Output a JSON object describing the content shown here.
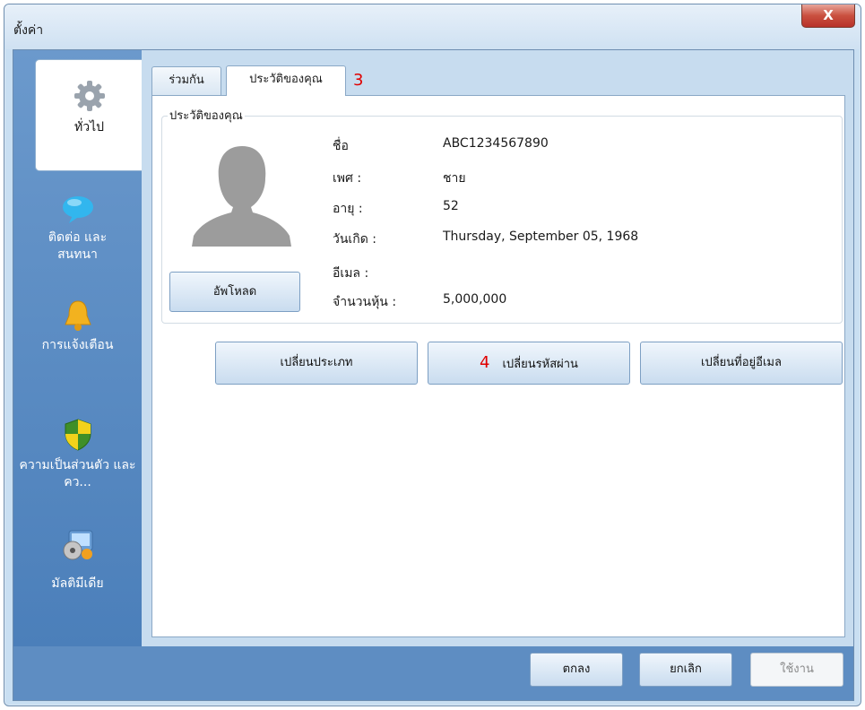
{
  "window": {
    "title": "ตั้งค่า",
    "close_label": "X"
  },
  "sidebar": {
    "items": [
      {
        "label": "ทั่วไป",
        "icon": "gear-icon"
      },
      {
        "label": "ติดต่อ และ สนทนา",
        "icon": "chat-bubble-icon"
      },
      {
        "label": "การแจ้งเตือน",
        "icon": "bell-icon"
      },
      {
        "label": "ความเป็นส่วนตัว และ คว...",
        "icon": "shield-icon"
      },
      {
        "label": "มัลติมีเดีย",
        "icon": "multimedia-icon"
      }
    ]
  },
  "tabs": [
    {
      "label": "ร่วมกัน"
    },
    {
      "label": "ประวัติของคุณ"
    }
  ],
  "annotations": {
    "tab_marker": "3",
    "button_marker": "4"
  },
  "profile": {
    "group_title": "ประวัติของคุณ",
    "upload_label": "อัพโหลด",
    "fields": [
      {
        "label": "ชื่อ",
        "value": "ABC1234567890"
      },
      {
        "label": "เพศ :",
        "value": "ชาย"
      },
      {
        "label": "อายุ :",
        "value": "52"
      },
      {
        "label": "วันเกิด :",
        "value": "Thursday, September 05, 1968"
      },
      {
        "label": "อีเมล :",
        "value": ""
      },
      {
        "label": "จำนวนหุ้น :",
        "value": "5,000,000"
      }
    ]
  },
  "actions": {
    "change_type": "เปลี่ยนประเภท",
    "change_password": "เปลี่ยนรหัสผ่าน",
    "change_email": "เปลี่ยนที่อยู่อีเมล"
  },
  "footer": {
    "ok": "ตกลง",
    "cancel": "ยกเลิก",
    "apply": "ใช้งาน"
  },
  "colors": {
    "accent": "#5e8dc2",
    "annotation": "#e00000",
    "close": "#c9503f"
  }
}
